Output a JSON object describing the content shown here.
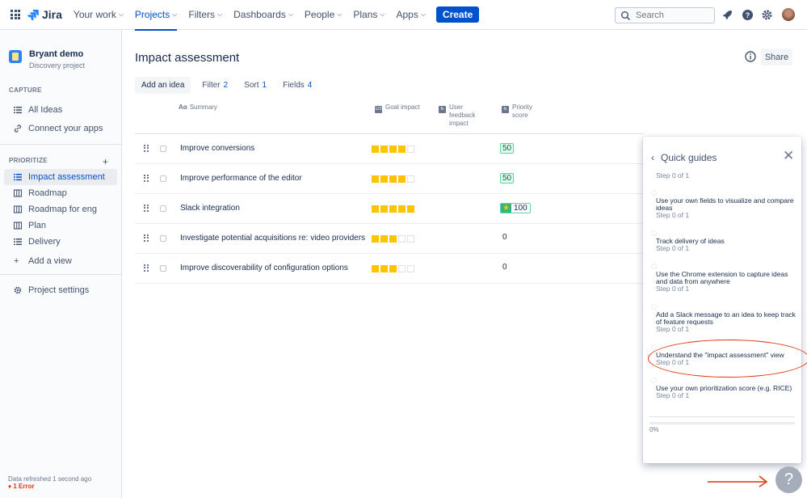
{
  "topnav": {
    "logo": "Jira",
    "items": [
      {
        "label": "Your work"
      },
      {
        "label": "Projects"
      },
      {
        "label": "Filters"
      },
      {
        "label": "Dashboards"
      },
      {
        "label": "People"
      },
      {
        "label": "Plans"
      },
      {
        "label": "Apps"
      }
    ],
    "create_label": "Create",
    "search_placeholder": "Search",
    "brand_color": "#0052cc"
  },
  "sidebar": {
    "project_name": "Bryant demo",
    "project_type": "Discovery project",
    "capture_title": "CAPTURE",
    "capture_items": [
      {
        "label": "All Ideas",
        "icon": "list-icon"
      },
      {
        "label": "Connect your apps",
        "icon": "link-icon"
      }
    ],
    "prioritize_title": "PRIORITIZE",
    "prioritize_items": [
      {
        "label": "Impact assessment",
        "icon": "list-icon"
      },
      {
        "label": "Roadmap",
        "icon": "board-icon"
      },
      {
        "label": "Roadmap for eng",
        "icon": "board-icon"
      },
      {
        "label": "Plan",
        "icon": "board-icon"
      },
      {
        "label": "Delivery",
        "icon": "list-icon"
      }
    ],
    "add_view": "Add a view",
    "project_settings": "Project settings",
    "refreshed": "Data refreshed 1 second ago",
    "error": "1 Error"
  },
  "main": {
    "title": "Impact assessment",
    "share": "Share",
    "toolbar": {
      "add_idea": "Add an idea",
      "filter": "Filter",
      "filter_count": "2",
      "sort": "Sort",
      "sort_count": "1",
      "fields": "Fields",
      "fields_count": "4"
    },
    "columns": {
      "summary": "Summary",
      "goal_impact": "Goal impact",
      "user_feedback_impact": "User feedback impact",
      "priority_score": "Priority score"
    },
    "rows": [
      {
        "title": "Improve conversions",
        "goal_impact": 4,
        "score": "50"
      },
      {
        "title": "Improve performance of the editor",
        "goal_impact": 4,
        "score": "50"
      },
      {
        "title": "Slack integration",
        "goal_impact": 5,
        "score": "100"
      },
      {
        "title": "Investigate potential acquisitions re: video providers",
        "goal_impact": 3,
        "score": "0"
      },
      {
        "title": "Improve discoverability of configuration options",
        "goal_impact": 3,
        "score": "0"
      }
    ]
  },
  "quick_guides": {
    "title": "Quick guides",
    "partial_step": "Step 0 of 1",
    "items": [
      {
        "name": "Use your own fields to visualize and compare ideas",
        "step": "Step 0 of 1"
      },
      {
        "name": "Track delivery of ideas",
        "step": "Step 0 of 1"
      },
      {
        "name": "Use the Chrome extension to capture ideas and data from anywhere",
        "step": "Step 0 of 1"
      },
      {
        "name": "Add a Slack message to an idea to keep track of feature requests",
        "step": "Step 0 of 1"
      },
      {
        "name": "Understand the \"impact assessment\" view",
        "step": "Step 0 of 1"
      },
      {
        "name": "Use your own prioritization score (e.g. RICE)",
        "step": "Step 0 of 1"
      }
    ],
    "progress_percent": 0,
    "progress_label": "0%"
  },
  "help": {
    "label": "?"
  },
  "annotation_color": "#de350b"
}
